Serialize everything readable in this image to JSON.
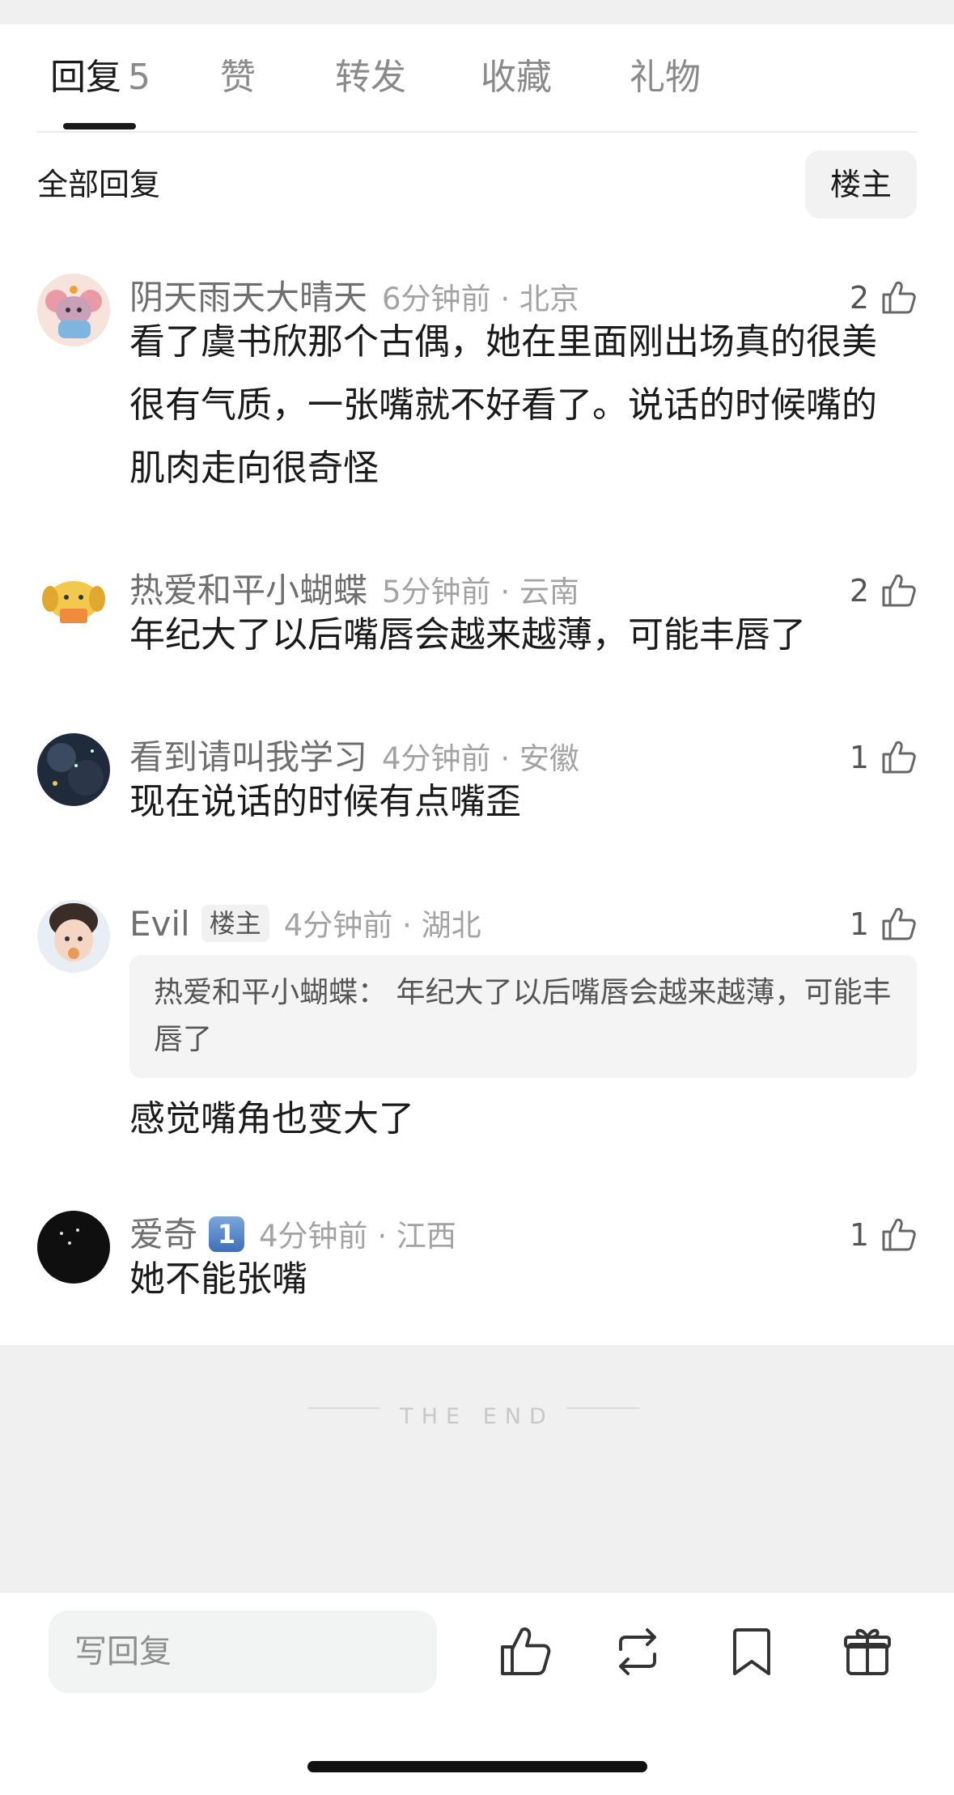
{
  "tabs": [
    {
      "label": "回复",
      "count": "5"
    },
    {
      "label": "赞"
    },
    {
      "label": "转发"
    },
    {
      "label": "收藏"
    },
    {
      "label": "礼物"
    }
  ],
  "section_title": "全部回复",
  "filter_button": "楼主",
  "comments": [
    {
      "name": "阴天雨天大晴天",
      "time": "6分钟前 · 北京",
      "likes": "2",
      "text": "看了虞书欣那个古偶，她在里面刚出场真的很美很有气质，一张嘴就不好看了。说话的时候嘴的肌肉走向很奇怪",
      "avatar": "mouse-avatar"
    },
    {
      "name": "热爱和平小蝴蝶",
      "time": "5分钟前 · 云南",
      "likes": "2",
      "text": "年纪大了以后嘴唇会越来越薄，可能丰唇了",
      "avatar": "dog-reading-avatar"
    },
    {
      "name": "看到请叫我学习",
      "time": "4分钟前 · 安徽",
      "likes": "1",
      "text": "现在说话的时候有点嘴歪",
      "avatar": "night-sky-avatar"
    },
    {
      "name": "Evil",
      "badge": "楼主",
      "time": "4分钟前 · 湖北",
      "likes": "1",
      "quote": "热爱和平小蝴蝶： 年纪大了以后嘴唇会越来越薄，可能丰唇了",
      "text": "感觉嘴角也变大了",
      "avatar": "baby-avatar"
    },
    {
      "name": "爱奇",
      "vbadge": "1",
      "time": "4分钟前 · 江西",
      "likes": "1",
      "text": "她不能张嘴",
      "avatar": "dark-stars-avatar"
    }
  ],
  "end_text": "THE END",
  "reply_placeholder": "写回复",
  "bottom_icons": [
    "thumbs-up-icon",
    "repost-icon",
    "bookmark-icon",
    "gift-icon"
  ]
}
